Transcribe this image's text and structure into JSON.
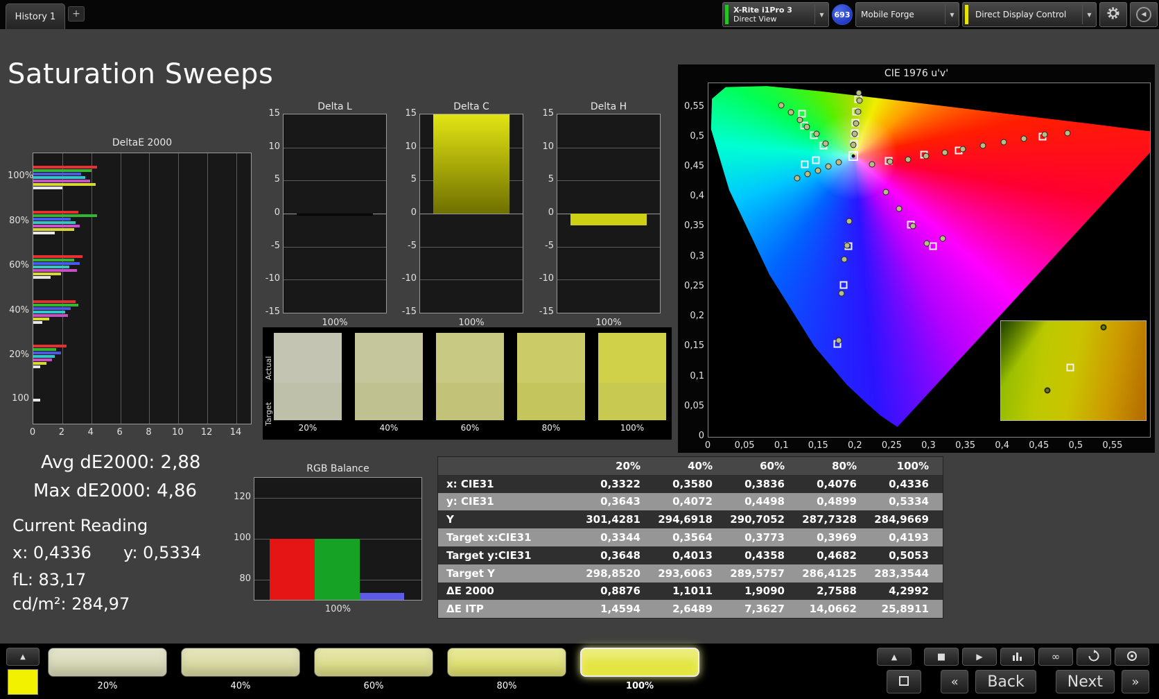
{
  "page_title": "Saturation Sweeps",
  "colors": {
    "background": "#3f3f3f",
    "panel_black": "#050505",
    "accent_yellow": "#e6e600",
    "meter_green": "#27c327",
    "badge_blue": "#1c35c8"
  },
  "topbar": {
    "tab_label": "History 1",
    "add_tab_label": "+",
    "meter_line1": "X-Rite i1Pro 3",
    "meter_line2": "Direct View",
    "badge_count": "693",
    "source_label": "Mobile Forge",
    "display_control_label": "Direct Display Control"
  },
  "readings": {
    "avg_label": "Avg dE2000: 2,88",
    "max_label": "Max dE2000: 4,86",
    "current_title": "Current Reading",
    "x_label": "x: 0,4336",
    "y_label": "y: 0,5334",
    "fl_label": "fL: 83,17",
    "cd_label": "cd/m²: 284,97"
  },
  "swatch_panel": {
    "actual_label": "Actual",
    "target_label": "Target",
    "columns": [
      {
        "label": "20%",
        "actual": "#c3c4b1",
        "target": "#bfc0a9"
      },
      {
        "label": "40%",
        "actual": "#c5c69b",
        "target": "#c0c191"
      },
      {
        "label": "60%",
        "actual": "#c8c983",
        "target": "#c2c378"
      },
      {
        "label": "80%",
        "actual": "#cbcc67",
        "target": "#c4c55c"
      },
      {
        "label": "100%",
        "actual": "#d0d148",
        "target": "#c8c951"
      }
    ]
  },
  "table": {
    "columns": [
      "",
      "20%",
      "40%",
      "60%",
      "80%",
      "100%"
    ],
    "rows": [
      {
        "label": "x: CIE31",
        "values": [
          "0,3322",
          "0,3580",
          "0,3836",
          "0,4076",
          "0,4336"
        ]
      },
      {
        "label": "y: CIE31",
        "values": [
          "0,3643",
          "0,4072",
          "0,4498",
          "0,4899",
          "0,5334"
        ]
      },
      {
        "label": "Y",
        "values": [
          "301,4281",
          "294,6918",
          "290,7052",
          "287,7328",
          "284,9669"
        ]
      },
      {
        "label": "Target x:CIE31",
        "values": [
          "0,3344",
          "0,3564",
          "0,3773",
          "0,3969",
          "0,4193"
        ]
      },
      {
        "label": "Target y:CIE31",
        "values": [
          "0,3648",
          "0,4013",
          "0,4358",
          "0,4682",
          "0,5053"
        ]
      },
      {
        "label": "Target Y",
        "values": [
          "298,8520",
          "293,6063",
          "289,5757",
          "286,4125",
          "283,3544"
        ]
      },
      {
        "label": "ΔE 2000",
        "values": [
          "0,8876",
          "1,1011",
          "1,9090",
          "2,7588",
          "4,2992"
        ]
      },
      {
        "label": "ΔE ITP",
        "values": [
          "1,4594",
          "2,6489",
          "7,3627",
          "14,0662",
          "25,8911"
        ]
      }
    ]
  },
  "bottom_bar": {
    "current_color": "#f2f200",
    "levels": [
      {
        "label": "20%",
        "color": "#d6d7b4",
        "active": false
      },
      {
        "label": "40%",
        "color": "#d8d9a0",
        "active": false
      },
      {
        "label": "60%",
        "color": "#dbdc88",
        "active": false
      },
      {
        "label": "80%",
        "color": "#dedf6e",
        "active": false
      },
      {
        "label": "100%",
        "color": "#e4e542",
        "active": true
      }
    ],
    "back_label": "Back",
    "next_label": "Next"
  },
  "chart_data": [
    {
      "id": "deltae2000",
      "type": "bar",
      "orientation": "horizontal",
      "title": "DeltaE 2000",
      "xlim": [
        0,
        15
      ],
      "xticks": [
        0,
        2,
        4,
        6,
        8,
        10,
        12,
        14
      ],
      "group_labels": [
        "100%",
        "80%",
        "60%",
        "40%",
        "20%",
        "100"
      ],
      "groups": [
        {
          "label": "100%",
          "bars": [
            {
              "color": "#e83030",
              "value": 4.4
            },
            {
              "color": "#35b535",
              "value": 4.0
            },
            {
              "color": "#4a5ae8",
              "value": 3.3
            },
            {
              "color": "#35c5c5",
              "value": 3.6
            },
            {
              "color": "#c84fc8",
              "value": 3.9
            },
            {
              "color": "#d8d835",
              "value": 4.3
            },
            {
              "color": "#e8e8e8",
              "value": 2.0
            }
          ]
        },
        {
          "label": "80%",
          "bars": [
            {
              "color": "#e83030",
              "value": 3.1
            },
            {
              "color": "#35b535",
              "value": 4.4
            },
            {
              "color": "#4a5ae8",
              "value": 2.6
            },
            {
              "color": "#35c5c5",
              "value": 2.9
            },
            {
              "color": "#c84fc8",
              "value": 3.2
            },
            {
              "color": "#d8d835",
              "value": 2.8
            },
            {
              "color": "#e8e8e8",
              "value": 1.5
            }
          ]
        },
        {
          "label": "60%",
          "bars": [
            {
              "color": "#e83030",
              "value": 3.4
            },
            {
              "color": "#35b535",
              "value": 2.8
            },
            {
              "color": "#4a5ae8",
              "value": 3.2
            },
            {
              "color": "#35c5c5",
              "value": 2.5
            },
            {
              "color": "#c84fc8",
              "value": 3.0
            },
            {
              "color": "#d8d835",
              "value": 1.9
            },
            {
              "color": "#e8e8e8",
              "value": 1.2
            }
          ]
        },
        {
          "label": "40%",
          "bars": [
            {
              "color": "#e83030",
              "value": 2.9
            },
            {
              "color": "#35b535",
              "value": 3.1
            },
            {
              "color": "#4a5ae8",
              "value": 2.6
            },
            {
              "color": "#35c5c5",
              "value": 2.2
            },
            {
              "color": "#c84fc8",
              "value": 2.4
            },
            {
              "color": "#d8d835",
              "value": 1.1
            },
            {
              "color": "#e8e8e8",
              "value": 0.6
            }
          ]
        },
        {
          "label": "20%",
          "bars": [
            {
              "color": "#e83030",
              "value": 2.3
            },
            {
              "color": "#35b535",
              "value": 1.6
            },
            {
              "color": "#4a5ae8",
              "value": 1.9
            },
            {
              "color": "#35c5c5",
              "value": 1.5
            },
            {
              "color": "#c84fc8",
              "value": 1.3
            },
            {
              "color": "#d8d835",
              "value": 0.9
            },
            {
              "color": "#e8e8e8",
              "value": 0.5
            }
          ]
        },
        {
          "label": "100",
          "bars": [
            {
              "color": "#e8e8e8",
              "value": 0.5
            }
          ]
        }
      ]
    },
    {
      "id": "delta_l",
      "type": "bar",
      "title": "Delta L",
      "ylim": [
        -15,
        15
      ],
      "yticks": [
        15,
        10,
        5,
        0,
        -5,
        -10,
        -15
      ],
      "categories": [
        "100%"
      ],
      "values": [
        -0.3
      ],
      "bar_colors": [
        "#101010"
      ]
    },
    {
      "id": "delta_c",
      "type": "bar",
      "title": "Delta C",
      "ylim": [
        -15,
        15
      ],
      "yticks": [
        15,
        10,
        5,
        0,
        -5,
        -10,
        -15
      ],
      "categories": [
        "100%"
      ],
      "values": [
        15
      ],
      "bar_colors": [
        "#d4d714"
      ]
    },
    {
      "id": "delta_h",
      "type": "bar",
      "title": "Delta H",
      "ylim": [
        -15,
        15
      ],
      "yticks": [
        15,
        10,
        5,
        0,
        -5,
        -10,
        -15
      ],
      "categories": [
        "100%"
      ],
      "values": [
        -1.8
      ],
      "bar_colors": [
        "#cdd014"
      ]
    },
    {
      "id": "rgb_balance",
      "type": "bar",
      "title": "RGB Balance",
      "ylim": [
        70,
        130
      ],
      "yticks": [
        80,
        100,
        120
      ],
      "categories": [
        "100%"
      ],
      "series": [
        {
          "name": "Red",
          "value": 100,
          "color": "#e61515"
        },
        {
          "name": "Green",
          "value": 100,
          "color": "#16a325"
        },
        {
          "name": "Blue",
          "value": 73.5,
          "color": "#5b5be6"
        }
      ]
    },
    {
      "id": "cie_diagram",
      "type": "scatter",
      "title": "CIE 1976 u'v'",
      "xlim": [
        0,
        0.6
      ],
      "ylim": [
        0,
        0.59
      ],
      "tick_values": [
        0,
        0.05,
        0.1,
        0.15,
        0.2,
        0.25,
        0.3,
        0.35,
        0.4,
        0.45,
        0.5,
        0.55
      ],
      "tick_labels": [
        "0",
        "0,05",
        "0,1",
        "0,15",
        "0,2",
        "0,25",
        "0,3",
        "0,35",
        "0,4",
        "0,45",
        "0,5",
        "0,55"
      ],
      "white_point": [
        0.197,
        0.468
      ],
      "targets": [
        [
          0.198,
          0.489
        ],
        [
          0.199,
          0.507
        ],
        [
          0.2,
          0.524
        ],
        [
          0.201,
          0.543
        ],
        [
          0.203,
          0.563
        ],
        [
          0.245,
          0.46
        ],
        [
          0.293,
          0.471
        ],
        [
          0.34,
          0.478
        ],
        [
          0.454,
          0.501
        ],
        [
          0.127,
          0.539
        ],
        [
          0.13,
          0.519
        ],
        [
          0.143,
          0.503
        ],
        [
          0.156,
          0.486
        ],
        [
          0.146,
          0.462
        ],
        [
          0.131,
          0.455
        ],
        [
          0.275,
          0.354
        ],
        [
          0.305,
          0.318
        ],
        [
          0.19,
          0.318
        ],
        [
          0.184,
          0.253
        ],
        [
          0.175,
          0.155
        ]
      ],
      "measurements": [
        [
          0.197,
          0.487
        ],
        [
          0.199,
          0.505
        ],
        [
          0.201,
          0.523
        ],
        [
          0.203,
          0.542
        ],
        [
          0.205,
          0.561
        ],
        [
          0.204,
          0.574
        ],
        [
          0.222,
          0.455
        ],
        [
          0.247,
          0.459
        ],
        [
          0.271,
          0.463
        ],
        [
          0.296,
          0.468
        ],
        [
          0.321,
          0.474
        ],
        [
          0.346,
          0.48
        ],
        [
          0.373,
          0.486
        ],
        [
          0.401,
          0.492
        ],
        [
          0.429,
          0.498
        ],
        [
          0.457,
          0.504
        ],
        [
          0.488,
          0.507
        ],
        [
          0.099,
          0.553
        ],
        [
          0.112,
          0.541
        ],
        [
          0.124,
          0.529
        ],
        [
          0.134,
          0.517
        ],
        [
          0.147,
          0.505
        ],
        [
          0.159,
          0.489
        ],
        [
          0.121,
          0.432
        ],
        [
          0.135,
          0.438
        ],
        [
          0.149,
          0.444
        ],
        [
          0.163,
          0.451
        ],
        [
          0.177,
          0.458
        ],
        [
          0.241,
          0.408
        ],
        [
          0.259,
          0.381
        ],
        [
          0.278,
          0.352
        ],
        [
          0.297,
          0.323
        ],
        [
          0.318,
          0.331
        ],
        [
          0.191,
          0.36
        ],
        [
          0.188,
          0.319
        ],
        [
          0.185,
          0.296
        ],
        [
          0.181,
          0.24
        ],
        [
          0.177,
          0.161
        ]
      ],
      "inset": {
        "marker_square": [
          0.48,
          0.47
        ],
        "dots": [
          [
            0.71,
            0.06
          ],
          [
            0.32,
            0.7
          ]
        ]
      }
    }
  ]
}
